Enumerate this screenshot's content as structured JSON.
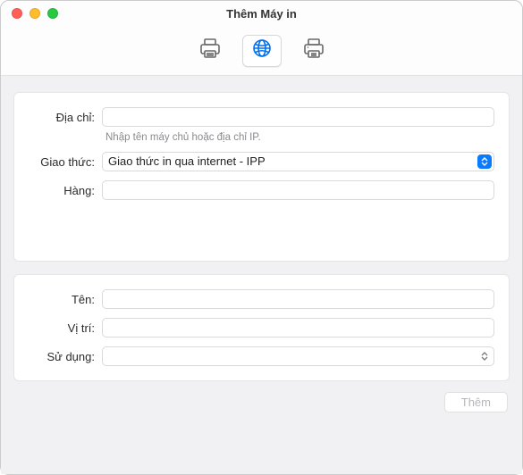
{
  "window": {
    "title": "Thêm Máy in"
  },
  "toolbar": {
    "tabs": [
      "default",
      "ip",
      "windows"
    ],
    "active_index": 1
  },
  "form_top": {
    "address_label": "Địa chỉ:",
    "address_value": "",
    "address_hint": "Nhập tên máy chủ hoặc địa chỉ IP.",
    "protocol_label": "Giao thức:",
    "protocol_value": "Giao thức in qua internet - IPP",
    "queue_label": "Hàng:",
    "queue_value": ""
  },
  "form_bottom": {
    "name_label": "Tên:",
    "name_value": "",
    "location_label": "Vị trí:",
    "location_value": "",
    "use_label": "Sử dụng:",
    "use_value": ""
  },
  "footer": {
    "add_button": "Thêm"
  }
}
